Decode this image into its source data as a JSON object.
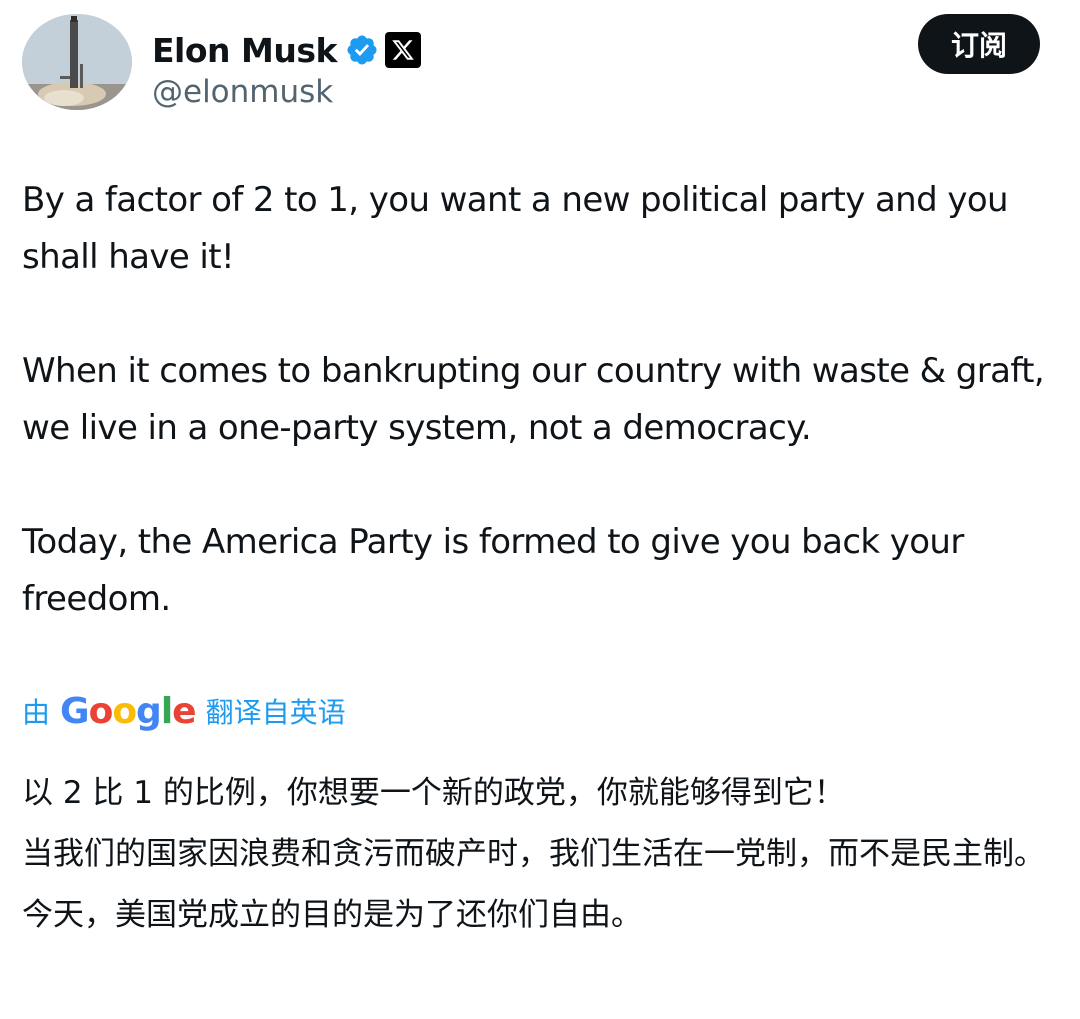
{
  "header": {
    "display_name": "Elon Musk",
    "handle": "@elonmusk",
    "subscribe_label": "订阅",
    "icons": {
      "avatar": "rocket-launch-avatar",
      "verified": "verified-badge-icon",
      "affiliation": "x-logo-icon"
    },
    "colors": {
      "verified": "#1d9bf0",
      "button_bg": "#0f1419"
    }
  },
  "tweet": {
    "paragraphs": [
      "By a factor of 2 to 1, you want a new political party and you shall have it!",
      "When it comes to bankrupting our country with waste & graft, we live in a one-party system, not a democracy.",
      "Today, the America Party is formed to give you back your freedom."
    ]
  },
  "translation": {
    "prefix": "由",
    "provider": "Google",
    "suffix": "翻译自英语",
    "link_color": "#1d9bf0",
    "paragraphs": [
      "以 2 比 1 的比例，你想要一个新的政党，你就能够得到它！",
      "当我们的国家因浪费和贪污而破产时，我们生活在一党制，而不是民主制。",
      "今天，美国党成立的目的是为了还你们自由。"
    ]
  }
}
